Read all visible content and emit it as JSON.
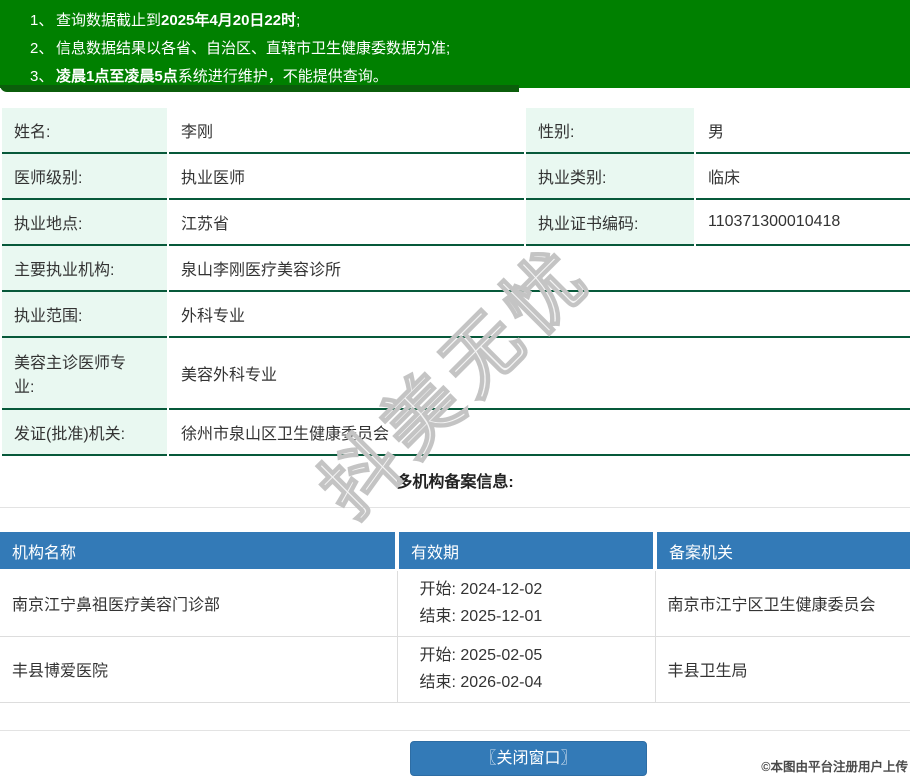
{
  "notice_panel": {
    "items": [
      {
        "number": "1、",
        "segments": [
          {
            "text": "查询数据截止到",
            "bold": false
          },
          {
            "text": "2025年4月20日22时",
            "bold": true
          },
          {
            "text": ";",
            "bold": false
          }
        ]
      },
      {
        "number": "2、",
        "segments": [
          {
            "text": "信息数据结果以各省、自治区、直辖市卫生健康委数据为准;",
            "bold": false
          }
        ]
      },
      {
        "number": "3、",
        "segments": [
          {
            "text": "凌晨1点至凌晨5点",
            "bold": true
          },
          {
            "text": "系统进行维护，不能提供查询。",
            "bold": false
          }
        ]
      }
    ]
  },
  "doctor_info": {
    "rows": [
      {
        "cells": [
          {
            "label": "姓名:",
            "value": "李刚"
          },
          {
            "label": "性别:",
            "value": "男"
          }
        ]
      },
      {
        "cells": [
          {
            "label": "医师级别:",
            "value": "执业医师"
          },
          {
            "label": "执业类别:",
            "value": "临床"
          }
        ]
      },
      {
        "cells": [
          {
            "label": "执业地点:",
            "value": "江苏省"
          },
          {
            "label": "执业证书编码:",
            "value": "110371300010418"
          }
        ]
      },
      {
        "cells": [
          {
            "label": "主要执业机构:",
            "value": "泉山李刚医疗美容诊所"
          }
        ]
      },
      {
        "cells": [
          {
            "label": "执业范围:",
            "value": "外科专业"
          }
        ]
      },
      {
        "cells": [
          {
            "label": "美容主诊医师专业:",
            "value": "美容外科专业"
          }
        ],
        "tall": true
      },
      {
        "cells": [
          {
            "label": "发证(批准)机关:",
            "value": "徐州市泉山区卫生健康委员会"
          }
        ]
      }
    ]
  },
  "filing_section": {
    "title": "多机构备案信息:",
    "table": {
      "headers": [
        "机构名称",
        "有效期",
        "备案机关"
      ],
      "rows": [
        {
          "org": "南京江宁鼻祖医疗美容门诊部",
          "start_label": "开始:",
          "start_date": "2024-12-02",
          "end_label": "结束:",
          "end_date": "2025-12-01",
          "authority": "南京市江宁区卫生健康委员会"
        },
        {
          "org": "丰县博爱医院",
          "start_label": "开始:",
          "start_date": "2025-02-05",
          "end_label": "结束:",
          "end_date": "2026-02-04",
          "authority": "丰县卫生局"
        }
      ]
    }
  },
  "close_button": {
    "label": "〖关闭窗口〗"
  },
  "watermark": {
    "text": "抖美无忧"
  },
  "credit": {
    "text": "©本图由平台注册用户上传"
  },
  "colors": {
    "header_green": "#008000",
    "header_green_dark": "#0b5e0b",
    "row_divider_green": "#07593a",
    "label_mint": "#e9f8f1",
    "accent_blue": "#337ab7",
    "light_border": "#e3e3e3",
    "text": "#333333",
    "watermark_gray": "#c4c4c4"
  }
}
